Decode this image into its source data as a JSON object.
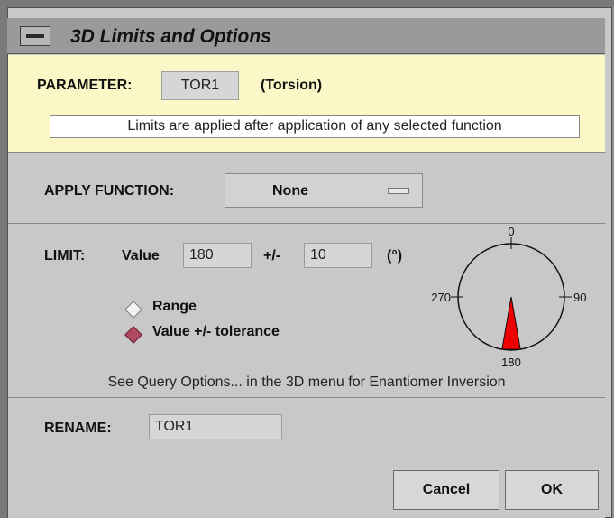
{
  "window": {
    "title": "3D Limits and Options"
  },
  "parameter": {
    "label": "PARAMETER:",
    "value": "TOR1",
    "description": "(Torsion)"
  },
  "notice": "Limits are applied after application of any selected function",
  "apply_function": {
    "label": "APPLY FUNCTION:",
    "value": "None"
  },
  "limit": {
    "label": "LIMIT:",
    "value_label": "Value",
    "value": "180",
    "tolerance_label": "+/-",
    "tolerance": "10",
    "units": "(°)",
    "options": [
      {
        "label": "Range",
        "selected": false
      },
      {
        "label": "Value +/- tolerance",
        "selected": true
      }
    ],
    "dial": {
      "labels": {
        "top": "0",
        "right": "90",
        "bottom": "180",
        "left": "270"
      },
      "value_deg": 180,
      "tolerance_deg": 10
    },
    "note": "See Query Options... in the 3D menu for Enantiomer Inversion"
  },
  "rename": {
    "label": "RENAME:",
    "value": "TOR1"
  },
  "buttons": {
    "cancel": "Cancel",
    "ok": "OK"
  },
  "colors": {
    "parameter_bg": "#fbf7c6",
    "dial_wedge": "#ee0000",
    "radio_selected": "#b04a62"
  }
}
